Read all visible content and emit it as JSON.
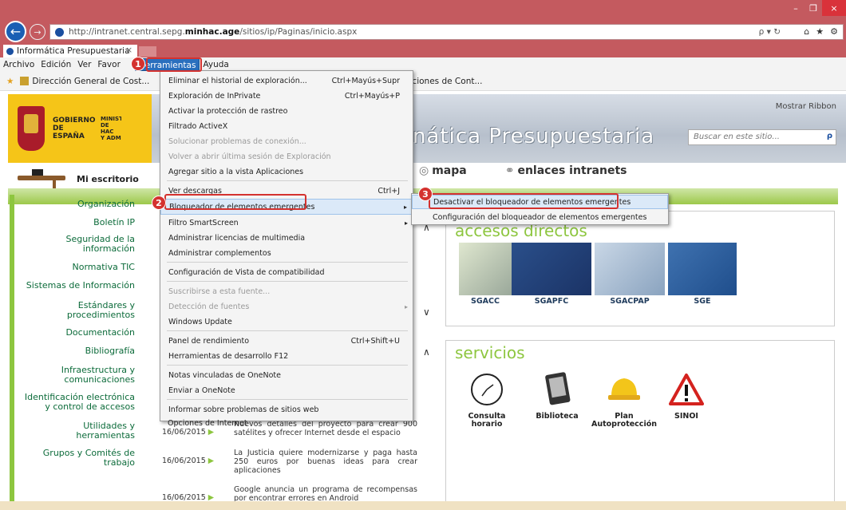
{
  "browser": {
    "url_prefix": "http://intranet.central.sepg.",
    "url_domain": "minhac.age",
    "url_suffix": "/sitios/ip/Paginas/inicio.aspx",
    "url_icons": "ρ ▾ ↻",
    "tab_title": "Informática Presupuestaria",
    "tab_close": "×",
    "window_buttons": [
      "–",
      "❐",
      "×"
    ],
    "toolbar_icons": [
      "⌂",
      "★",
      "⚙"
    ]
  },
  "menubar": {
    "items": [
      "Archivo",
      "Edición",
      "Ver",
      "Favor",
      "Herramientas",
      "Ayuda"
    ]
  },
  "favorites": {
    "item1": "Dirección General de Cost...",
    "item2": "aciones de Cont..."
  },
  "header": {
    "gobierno": "GOBIERNO\nDE ESPAÑA",
    "ministerio": "MINIST\nDE HAC\nY ADM",
    "site_title": "nática Presupuestaria",
    "ribbon": "Mostrar Ribbon",
    "search_placeholder": "Buscar en este sitio...",
    "search_icon": "ρ"
  },
  "nav": {
    "my_desk": "Mi escritorio",
    "mapa": "mapa",
    "enlaces": "enlaces intranets"
  },
  "sidebar": {
    "items": [
      "Organización",
      "Boletín IP",
      "Seguridad de la\ninformación",
      "Normativa TIC",
      "Sistemas de Información",
      "Estándares y\nprocedimientos",
      "Documentación",
      "Bibliografía",
      "Infraestructura y\ncomunicaciones",
      "Identificación electrónica\ny control de accesos",
      "Utilidades y\nherramientas",
      "Grupos y Comités de\ntrabajo"
    ]
  },
  "news": [
    {
      "date": "16/06/2015",
      "text": "Nuevos detalles del proyecto para crear 900 satélites y ofrecer Internet desde el espacio"
    },
    {
      "date": "16/06/2015",
      "text": "La Justicia quiere modernizarse y paga hasta 250 euros por buenas ideas para crear aplicaciones"
    },
    {
      "date": "16/06/2015",
      "text": "Google anuncia un programa de recompensas por encontrar errores en Android"
    }
  ],
  "accesos": {
    "title": "accesos directos",
    "items": [
      "SGACC",
      "SGAPFC",
      "SGACPAP",
      "SGE"
    ]
  },
  "servicios": {
    "title": "servicios",
    "items": [
      "Consulta\nhorario",
      "Biblioteca",
      "Plan\nAutoprotección",
      "SINOI"
    ]
  },
  "tools_menu": {
    "items": [
      {
        "label": "Eliminar el historial de exploración...",
        "shortcut": "Ctrl+Mayús+Supr"
      },
      {
        "label": "Exploración de InPrivate",
        "shortcut": "Ctrl+Mayús+P"
      },
      {
        "label": "Activar la protección de rastreo",
        "shortcut": ""
      },
      {
        "label": "Filtrado ActiveX",
        "shortcut": ""
      },
      {
        "label": "Solucionar problemas de conexión...",
        "shortcut": ""
      },
      {
        "label": "Volver a abrir última sesión de Exploración",
        "shortcut": ""
      },
      {
        "label": "Agregar sitio a la vista Aplicaciones",
        "shortcut": ""
      },
      {
        "label": "Ver descargas",
        "shortcut": "Ctrl+J"
      },
      {
        "label": "Bloqueador de elementos emergentes",
        "shortcut": ""
      },
      {
        "label": "Filtro SmartScreen",
        "shortcut": ""
      },
      {
        "label": "Administrar licencias de multimedia",
        "shortcut": ""
      },
      {
        "label": "Administrar complementos",
        "shortcut": ""
      },
      {
        "label": "Configuración de Vista de compatibilidad",
        "shortcut": ""
      },
      {
        "label": "Suscribirse a esta fuente...",
        "shortcut": ""
      },
      {
        "label": "Detección de fuentes",
        "shortcut": ""
      },
      {
        "label": "Windows Update",
        "shortcut": ""
      },
      {
        "label": "Panel de rendimiento",
        "shortcut": "Ctrl+Shift+U"
      },
      {
        "label": "Herramientas de desarrollo F12",
        "shortcut": ""
      },
      {
        "label": "Notas vinculadas de OneNote",
        "shortcut": ""
      },
      {
        "label": "Enviar a OneNote",
        "shortcut": ""
      },
      {
        "label": "Informar sobre problemas de sitios web",
        "shortcut": ""
      },
      {
        "label": "Opciones de Internet",
        "shortcut": ""
      }
    ],
    "submenu_arrow": "▸"
  },
  "popup_submenu": {
    "items": [
      "Desactivar el bloqueador de elementos emergentes",
      "Configuración del bloqueador de elementos emergentes"
    ]
  },
  "callouts": [
    "1",
    "2",
    "3"
  ]
}
